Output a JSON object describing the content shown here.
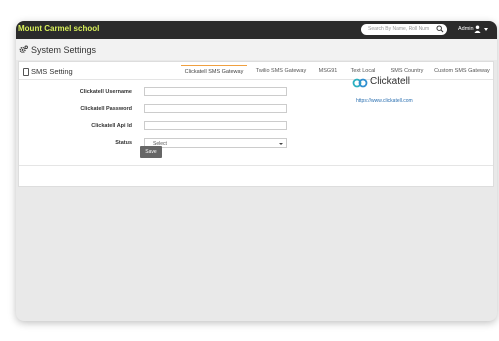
{
  "header": {
    "school_name": "Mount Carmel school",
    "search_placeholder": "Search By Name, Roll Num",
    "user_label": "Admin"
  },
  "page": {
    "title": "System Settings"
  },
  "card": {
    "title": "SMS Setting",
    "tabs": [
      {
        "label": "Clickatell SMS Gateway",
        "active": true
      },
      {
        "label": "Twilio SMS Gateway",
        "active": false
      },
      {
        "label": "MSG91",
        "active": false
      },
      {
        "label": "Text Local",
        "active": false
      },
      {
        "label": "SMS Country",
        "active": false
      },
      {
        "label": "Custom SMS Gateway",
        "active": false
      }
    ],
    "form": {
      "username_label": "Clickatell Username",
      "username_value": "",
      "password_label": "Clickatell Password",
      "password_value": "",
      "api_label": "Clickatell Api Id",
      "api_value": "",
      "status_label": "Status",
      "status_selected": "Select"
    },
    "provider": {
      "logo_text": "Clickatell",
      "link": "https://www.clickatell.com"
    },
    "save_label": "Save"
  },
  "colors": {
    "topbar": "#2b2b2b",
    "school_name": "#d8f05a",
    "active_tab": "#f0a040",
    "logo_accent": "#2ab0c0",
    "save_button": "#666666"
  }
}
